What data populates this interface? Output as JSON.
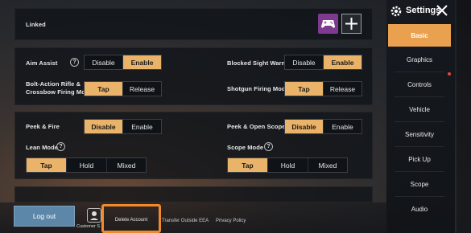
{
  "header": {
    "title": "Settings"
  },
  "sidebar": {
    "items": [
      {
        "label": "Basic",
        "active": true
      },
      {
        "label": "Graphics",
        "active": false
      },
      {
        "label": "Controls",
        "active": false,
        "badge": true
      },
      {
        "label": "Vehicle",
        "active": false
      },
      {
        "label": "Sensitivity",
        "active": false
      },
      {
        "label": "Pick Up",
        "active": false
      },
      {
        "label": "Scope",
        "active": false
      },
      {
        "label": "Audio",
        "active": false
      }
    ]
  },
  "linked": {
    "label": "Linked"
  },
  "settings1": {
    "aim_assist": {
      "label": "Aim Assist",
      "options": [
        "Disable",
        "Enable"
      ],
      "selected": "Enable"
    },
    "blocked_sight": {
      "label": "Blocked Sight Warning",
      "options": [
        "Disable",
        "Enable"
      ],
      "selected": "Enable"
    },
    "bolt_action": {
      "label_line1": "Bolt-Action Rifle &",
      "label_line2": "Crossbow Firing Mode",
      "options": [
        "Tap",
        "Release"
      ],
      "selected": "Tap"
    },
    "shotgun": {
      "label": "Shotgun Firing Mode",
      "options": [
        "Tap",
        "Release"
      ],
      "selected": "Tap"
    }
  },
  "settings2": {
    "peek_fire": {
      "label": "Peek & Fire",
      "options": [
        "Disable",
        "Enable"
      ],
      "selected": "Disable"
    },
    "peek_scope": {
      "label": "Peek & Open Scope",
      "options": [
        "Disable",
        "Enable"
      ],
      "selected": "Disable"
    },
    "lean_mode": {
      "label": "Lean Mode",
      "options": [
        "Tap",
        "Hold",
        "Mixed"
      ],
      "selected": "Tap"
    },
    "scope_mode": {
      "label": "Scope Mode",
      "options": [
        "Tap",
        "Hold",
        "Mixed"
      ],
      "selected": "Tap"
    }
  },
  "bottom": {
    "logout": "Log out",
    "customer": "Customer S",
    "delete_account": "Delete Account",
    "transfer": "Transfer Outside EEA",
    "privacy": "Privacy Policy"
  },
  "colors": {
    "accent": "#e9b36a",
    "active_tab": "#e9a14f",
    "highlight_box": "#f08a2c",
    "logout_button": "#5d87a8"
  }
}
